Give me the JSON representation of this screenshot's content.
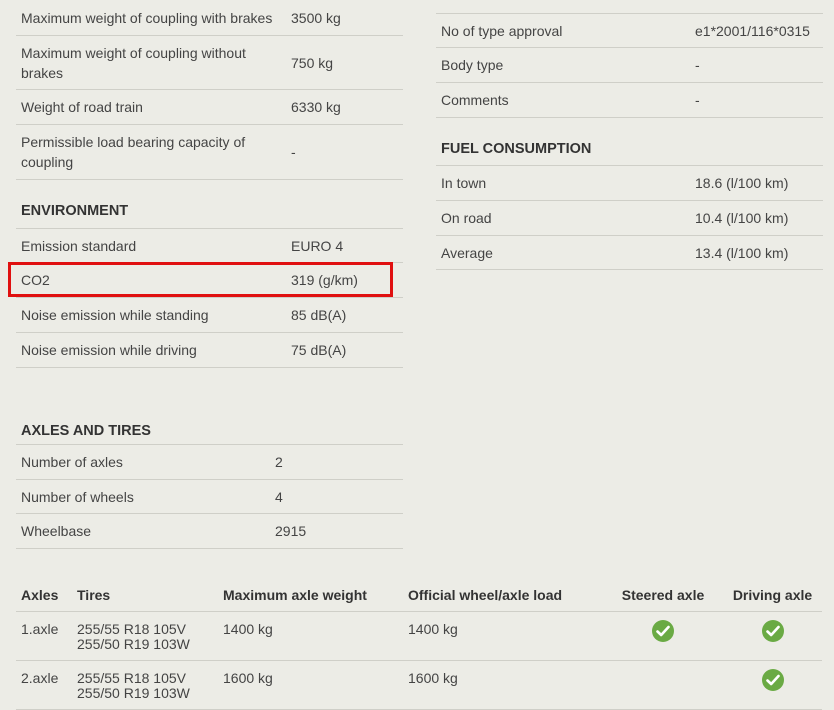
{
  "left": {
    "top_rows": [
      {
        "label": "Maximum weight of coupling with brakes",
        "value": "3500 kg"
      },
      {
        "label": "Maximum weight of coupling without brakes",
        "value": "750 kg"
      },
      {
        "label": "Weight of road train",
        "value": "6330 kg"
      },
      {
        "label": "Permissible load bearing capacity of coupling",
        "value": "-"
      }
    ],
    "environment": {
      "title": "ENVIRONMENT",
      "rows": [
        {
          "label": "Emission standard",
          "value": "EURO 4"
        },
        {
          "label": "CO2",
          "value": "319 (g/km)"
        },
        {
          "label": "Noise emission while standing",
          "value": "85 dB(A)"
        },
        {
          "label": "Noise emission while driving",
          "value": "75 dB(A)"
        }
      ]
    },
    "axles_tires": {
      "title": "AXLES AND TIRES",
      "rows": [
        {
          "label": "Number of axles",
          "value": "2"
        },
        {
          "label": "Number of wheels",
          "value": "4"
        },
        {
          "label": "Wheelbase",
          "value": "2915"
        }
      ]
    }
  },
  "right": {
    "top_rows": [
      {
        "label": "No of type approval",
        "value": "e1*2001/116*0315"
      },
      {
        "label": "Body type",
        "value": "-"
      },
      {
        "label": "Comments",
        "value": "-"
      }
    ],
    "fuel": {
      "title": "FUEL CONSUMPTION",
      "rows": [
        {
          "label": "In town",
          "value": "18.6 (l/100 km)"
        },
        {
          "label": "On road",
          "value": "10.4 (l/100 km)"
        },
        {
          "label": "Average",
          "value": "13.4 (l/100 km)"
        }
      ]
    }
  },
  "axle_table": {
    "headers": [
      "Axles",
      "Tires",
      "Maximum axle weight",
      "Official wheel/axle load",
      "Steered axle",
      "Driving axle"
    ],
    "rows": [
      {
        "axle": "1.axle",
        "tire1": "255/55 R18 105V",
        "tire2": "255/50 R19 103W",
        "max": "1400 kg",
        "official": "1400 kg",
        "steered": true,
        "driving": true
      },
      {
        "axle": "2.axle",
        "tire1": "255/55 R18 105V",
        "tire2": "255/50 R19 103W",
        "max": "1600 kg",
        "official": "1600 kg",
        "steered": false,
        "driving": true
      }
    ],
    "check_icon_color": "#6aaa44"
  },
  "highlight_color": "#e01010"
}
